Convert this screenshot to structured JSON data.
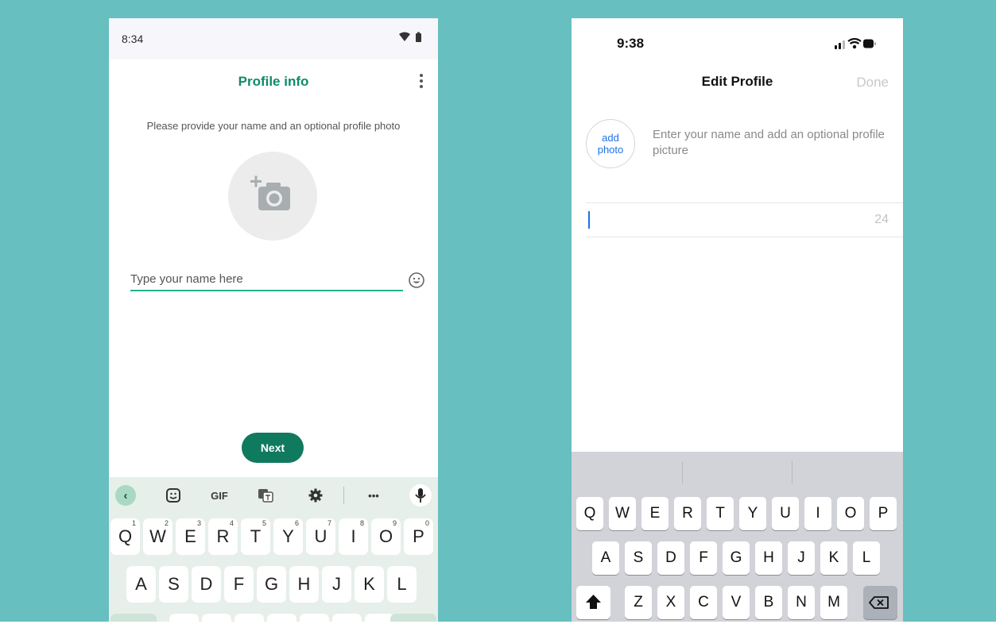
{
  "android": {
    "status": {
      "time": "8:34"
    },
    "title": "Profile info",
    "subtitle": "Please provide your name and an optional profile photo",
    "name_placeholder": "Type your name here",
    "next_label": "Next",
    "keyboard": {
      "toolbar": {
        "gif_label": "GIF",
        "more_label": "•••"
      },
      "row1": [
        {
          "letter": "Q",
          "hint": "1"
        },
        {
          "letter": "W",
          "hint": "2"
        },
        {
          "letter": "E",
          "hint": "3"
        },
        {
          "letter": "R",
          "hint": "4"
        },
        {
          "letter": "T",
          "hint": "5"
        },
        {
          "letter": "Y",
          "hint": "6"
        },
        {
          "letter": "U",
          "hint": "7"
        },
        {
          "letter": "I",
          "hint": "8"
        },
        {
          "letter": "O",
          "hint": "9"
        },
        {
          "letter": "P",
          "hint": "0"
        }
      ],
      "row2": [
        "A",
        "S",
        "D",
        "F",
        "G",
        "H",
        "J",
        "K",
        "L"
      ]
    }
  },
  "ios": {
    "status": {
      "time": "9:38"
    },
    "title": "Edit Profile",
    "done_label": "Done",
    "add_photo_line1": "add",
    "add_photo_line2": "photo",
    "hint": "Enter your name and add an optional profile picture",
    "char_count": "24",
    "keyboard": {
      "row1": [
        "Q",
        "W",
        "E",
        "R",
        "T",
        "Y",
        "U",
        "I",
        "O",
        "P"
      ],
      "row2": [
        "A",
        "S",
        "D",
        "F",
        "G",
        "H",
        "J",
        "K",
        "L"
      ],
      "row3": [
        "Z",
        "X",
        "C",
        "V",
        "B",
        "N",
        "M"
      ]
    }
  },
  "colors": {
    "background": "#67bfbf",
    "whatsapp_green": "#0f8a6a",
    "next_button": "#0f7a5e",
    "ios_blue": "#1a73e8"
  }
}
